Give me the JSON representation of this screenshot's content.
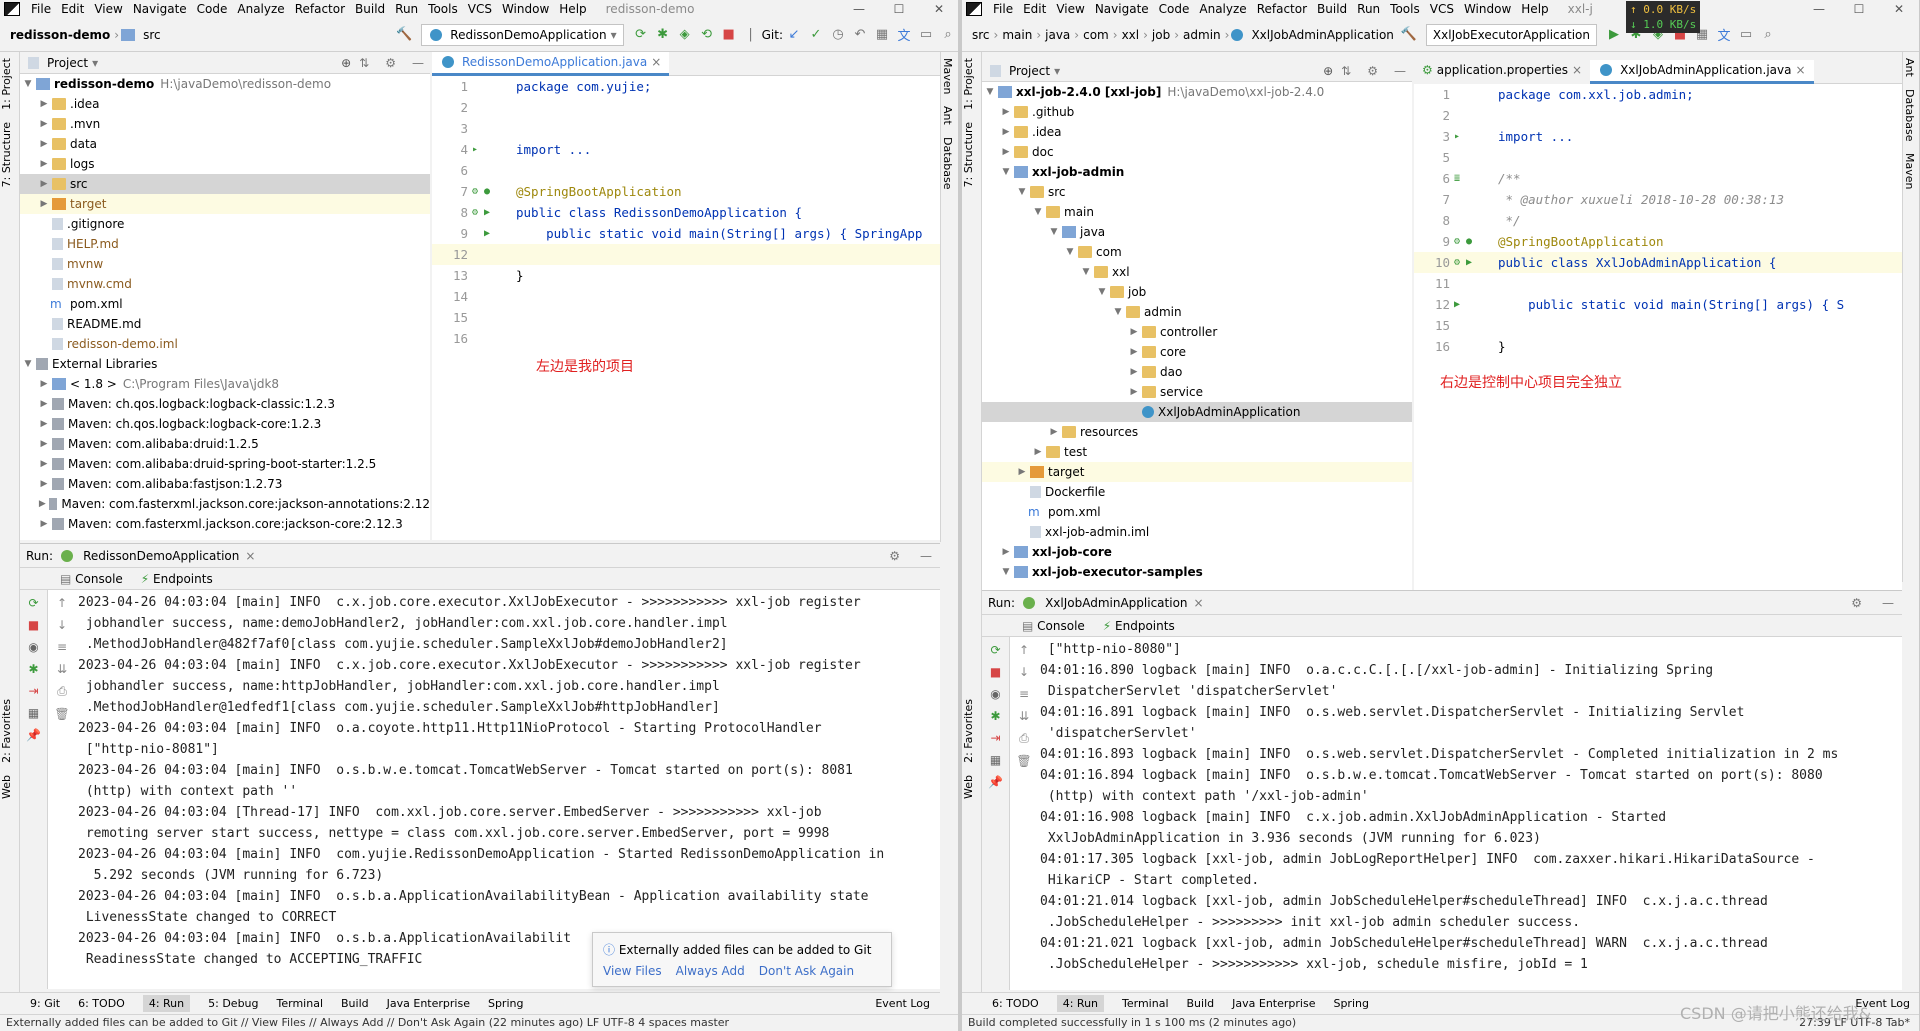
{
  "left": {
    "menu": [
      "File",
      "Edit",
      "View",
      "Navigate",
      "Code",
      "Analyze",
      "Refactor",
      "Build",
      "Run",
      "Tools",
      "VCS",
      "Window",
      "Help"
    ],
    "window_title": "redisson-demo",
    "breadcrumb": [
      "redisson-demo",
      "src"
    ],
    "run_config": "RedissonDemoApplication",
    "git_label": "Git:",
    "side_left": [
      "1: Project",
      "7: Structure",
      "2: Favorites",
      "Web"
    ],
    "side_right": [
      "Maven",
      "Ant",
      "Database"
    ],
    "project_header": "Project",
    "tree": [
      {
        "label": "redisson-demo",
        "extra": "H:\\javaDemo\\redisson-demo",
        "bold": true
      },
      {
        "label": ".idea"
      },
      {
        "label": ".mvn"
      },
      {
        "label": "data"
      },
      {
        "label": "logs"
      },
      {
        "label": "src"
      },
      {
        "label": "target"
      },
      {
        "label": ".gitignore"
      },
      {
        "label": "HELP.md"
      },
      {
        "label": "mvnw"
      },
      {
        "label": "mvnw.cmd"
      },
      {
        "label": "pom.xml"
      },
      {
        "label": "README.md"
      },
      {
        "label": "redisson-demo.iml"
      },
      {
        "label": "External Libraries"
      },
      {
        "label": "< 1.8 >",
        "extra": "C:\\Program Files\\Java\\jdk8"
      },
      {
        "label": "Maven: ch.qos.logback:logback-classic:1.2.3"
      },
      {
        "label": "Maven: ch.qos.logback:logback-core:1.2.3"
      },
      {
        "label": "Maven: com.alibaba:druid:1.2.5"
      },
      {
        "label": "Maven: com.alibaba:druid-spring-boot-starter:1.2.5"
      },
      {
        "label": "Maven: com.alibaba:fastjson:1.2.73"
      },
      {
        "label": "Maven: com.fasterxml.jackson.core:jackson-annotations:2.12"
      },
      {
        "label": "Maven: com.fasterxml.jackson.core:jackson-core:2.12.3"
      }
    ],
    "editor_tab": "RedissonDemoApplication.java",
    "code_lines": [
      {
        "n": "1",
        "t": "package com.yujie;"
      },
      {
        "n": "2",
        "t": ""
      },
      {
        "n": "3",
        "t": ""
      },
      {
        "n": "4",
        "t": "import ..."
      },
      {
        "n": "6",
        "t": ""
      },
      {
        "n": "7",
        "t": "@SpringBootApplication"
      },
      {
        "n": "8",
        "t": "public class RedissonDemoApplication {"
      },
      {
        "n": "9",
        "t": "    public static void main(String[] args) { SpringApp"
      },
      {
        "n": "12",
        "t": ""
      },
      {
        "n": "13",
        "t": "}"
      },
      {
        "n": "14",
        "t": ""
      },
      {
        "n": "15",
        "t": ""
      },
      {
        "n": "16",
        "t": ""
      }
    ],
    "annotation": "左边是我的项目",
    "run_label": "Run:",
    "run_tab": "RedissonDemoApplication",
    "console_tab": "Console",
    "endpoints_tab": "Endpoints",
    "console": "2023-04-26 04:03:04 [main] INFO  c.x.job.core.executor.XxlJobExecutor - >>>>>>>>>>> xxl-job register\n jobhandler success, name:demoJobHandler2, jobHandler:com.xxl.job.core.handler.impl\n .MethodJobHandler@482f7af0[class com.yujie.scheduler.SampleXxlJob#demoJobHandler2]\n2023-04-26 04:03:04 [main] INFO  c.x.job.core.executor.XxlJobExecutor - >>>>>>>>>>> xxl-job register\n jobhandler success, name:httpJobHandler, jobHandler:com.xxl.job.core.handler.impl\n .MethodJobHandler@1edfedf1[class com.yujie.scheduler.SampleXxlJob#httpJobHandler]\n2023-04-26 04:03:04 [main] INFO  o.a.coyote.http11.Http11NioProtocol - Starting ProtocolHandler\n [\"http-nio-8081\"]\n2023-04-26 04:03:04 [main] INFO  o.s.b.w.e.tomcat.TomcatWebServer - Tomcat started on port(s): 8081\n (http) with context path ''\n2023-04-26 04:03:04 [Thread-17] INFO  com.xxl.job.core.server.EmbedServer - >>>>>>>>>>> xxl-job\n remoting server start success, nettype = class com.xxl.job.core.server.EmbedServer, port = 9998\n2023-04-26 04:03:04 [main] INFO  com.yujie.RedissonDemoApplication - Started RedissonDemoApplication in\n  5.292 seconds (JVM running for 6.723)\n2023-04-26 04:03:04 [main] INFO  o.s.b.a.ApplicationAvailabilityBean - Application availability state\n LivenessState changed to CORRECT\n2023-04-26 04:03:04 [main] INFO  o.s.b.a.ApplicationAvailabilit\n ReadinessState changed to ACCEPTING_TRAFFIC",
    "notification": {
      "text": "Externally added files can be added to Git",
      "links": [
        "View Files",
        "Always Add",
        "Don't Ask Again"
      ]
    },
    "bottom_tools": [
      "9: Git",
      "6: TODO",
      "4: Run",
      "5: Debug",
      "Terminal",
      "Build",
      "Java Enterprise",
      "Spring",
      "Event Log"
    ],
    "status": "Externally added files can be added to Git // View Files // Always Add // Don't Ask Again (22 minutes ago)     LF   UTF-8   4 spaces   master"
  },
  "right": {
    "menu": [
      "File",
      "Edit",
      "View",
      "Navigate",
      "Code",
      "Analyze",
      "Refactor",
      "Build",
      "Run",
      "Tools",
      "VCS",
      "Window",
      "Help"
    ],
    "window_title": "xxl-j",
    "net_up": "↑ 0.0 KB/s",
    "net_down": "↓ 1.0 KB/s",
    "breadcrumb": [
      "src",
      "main",
      "java",
      "com",
      "xxl",
      "job",
      "admin",
      "XxlJobAdminApplication"
    ],
    "run_config": "XxlJobExecutorApplication",
    "side_left": [
      "1: Project",
      "7: Structure",
      "2: Favorites",
      "Web"
    ],
    "side_right": [
      "Ant",
      "Database",
      "Maven"
    ],
    "project_header": "Project",
    "tree": [
      {
        "label": "xxl-job-2.4.0 [xxl-job]",
        "extra": "H:\\javaDemo\\xxl-job-2.4.0",
        "bold": true
      },
      {
        "label": ".github"
      },
      {
        "label": ".idea"
      },
      {
        "label": "doc"
      },
      {
        "label": "xxl-job-admin",
        "bold": true
      },
      {
        "label": "src"
      },
      {
        "label": "main"
      },
      {
        "label": "java"
      },
      {
        "label": "com"
      },
      {
        "label": "xxl"
      },
      {
        "label": "job"
      },
      {
        "label": "admin"
      },
      {
        "label": "controller"
      },
      {
        "label": "core"
      },
      {
        "label": "dao"
      },
      {
        "label": "service"
      },
      {
        "label": "XxlJobAdminApplication"
      },
      {
        "label": "resources"
      },
      {
        "label": "test"
      },
      {
        "label": "target"
      },
      {
        "label": "Dockerfile"
      },
      {
        "label": "pom.xml"
      },
      {
        "label": "xxl-job-admin.iml"
      },
      {
        "label": "xxl-job-core",
        "bold": true
      },
      {
        "label": "xxl-job-executor-samples",
        "bold": true
      }
    ],
    "editor_tabs": [
      "application.properties",
      "XxlJobAdminApplication.java"
    ],
    "code_lines": [
      {
        "n": "1",
        "t": "package com.xxl.job.admin;"
      },
      {
        "n": "2",
        "t": ""
      },
      {
        "n": "3",
        "t": "import ..."
      },
      {
        "n": "5",
        "t": ""
      },
      {
        "n": "6",
        "t": "/**"
      },
      {
        "n": "7",
        "t": " * @author xuxueli 2018-10-28 00:38:13"
      },
      {
        "n": "8",
        "t": " */"
      },
      {
        "n": "9",
        "t": "@SpringBootApplication"
      },
      {
        "n": "10",
        "t": "public class XxlJobAdminApplication {"
      },
      {
        "n": "11",
        "t": ""
      },
      {
        "n": "12",
        "t": "    public static void main(String[] args) { S"
      },
      {
        "n": "15",
        "t": ""
      },
      {
        "n": "16",
        "t": "}"
      }
    ],
    "annotation": "右边是控制中心项目完全独立",
    "run_label": "Run:",
    "run_tab": "XxlJobAdminApplication",
    "console_tab": "Console",
    "endpoints_tab": "Endpoints",
    "console": " [\"http-nio-8080\"]\n04:01:16.890 logback [main] INFO  o.a.c.c.C.[.[.[/xxl-job-admin] - Initializing Spring\n DispatcherServlet 'dispatcherServlet'\n04:01:16.891 logback [main] INFO  o.s.web.servlet.DispatcherServlet - Initializing Servlet\n 'dispatcherServlet'\n04:01:16.893 logback [main] INFO  o.s.web.servlet.DispatcherServlet - Completed initialization in 2 ms\n04:01:16.894 logback [main] INFO  o.s.b.w.e.tomcat.TomcatWebServer - Tomcat started on port(s): 8080\n (http) with context path '/xxl-job-admin'\n04:01:16.908 logback [main] INFO  c.x.job.admin.XxlJobAdminApplication - Started\n XxlJobAdminApplication in 3.936 seconds (JVM running for 6.023)\n04:01:17.305 logback [xxl-job, admin JobLogReportHelper] INFO  com.zaxxer.hikari.HikariDataSource -\n HikariCP - Start completed.\n04:01:21.014 logback [xxl-job, admin JobScheduleHelper#scheduleThread] INFO  c.x.j.a.c.thread\n .JobScheduleHelper - >>>>>>>>> init xxl-job admin scheduler success.\n04:01:21.021 logback [xxl-job, admin JobScheduleHelper#scheduleThread] WARN  c.x.j.a.c.thread\n .JobScheduleHelper - >>>>>>>>>>> xxl-job, schedule misfire, jobId = 1",
    "bottom_tools": [
      "6: TODO",
      "4: Run",
      "Terminal",
      "Build",
      "Java Enterprise",
      "Spring",
      "Event Log"
    ],
    "status": "Build completed successfully in 1 s 100 ms (2 minutes ago)",
    "status_right": "27:39   LF   UTF-8   Tab*",
    "watermark": "CSDN @请把小熊还给我&"
  }
}
